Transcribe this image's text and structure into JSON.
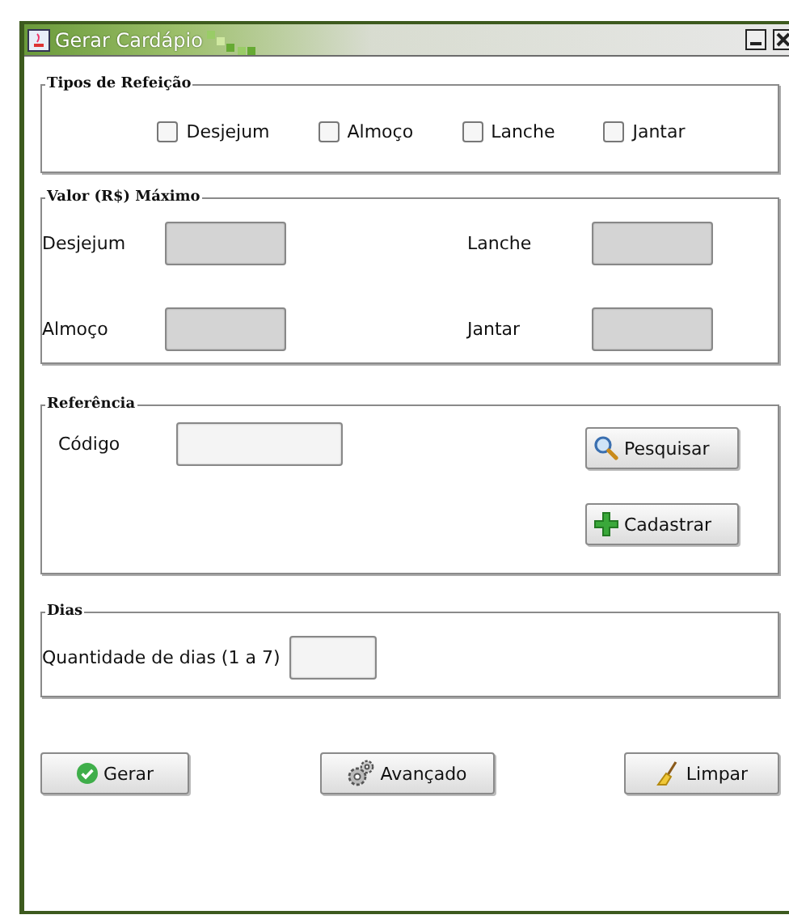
{
  "window": {
    "title": "Gerar Cardápio"
  },
  "groups": [
    {
      "kind": "checks",
      "title": "Tipos de Refeição",
      "items": [
        {
          "label": "Desjejum",
          "checked": false
        },
        {
          "label": "Almoço",
          "checked": false
        },
        {
          "label": "Lanche",
          "checked": false
        },
        {
          "label": "Jantar",
          "checked": false
        }
      ]
    },
    {
      "kind": "prices",
      "title": "Valor (R$) Máximo",
      "fields": [
        {
          "label": "Desjejum",
          "disabled": true
        },
        {
          "label": "Lanche",
          "disabled": true
        },
        {
          "label": "Almoço",
          "disabled": true
        },
        {
          "label": "Jantar",
          "disabled": true
        }
      ]
    },
    {
      "kind": "reference",
      "title": "Referência",
      "field": {
        "label": "Código",
        "disabled": false
      },
      "buttons": [
        {
          "label": "Pesquisar",
          "kind": "search"
        },
        {
          "label": "Cadastrar",
          "kind": "add"
        }
      ]
    },
    {
      "kind": "days",
      "title": "Dias",
      "field": {
        "label": "Quantidade de dias (1 a 7)",
        "disabled": false
      }
    }
  ],
  "buttons": [
    {
      "label": "Gerar",
      "kind": "generate"
    },
    {
      "label": "Avançado",
      "kind": "advanced"
    },
    {
      "label": "Limpar",
      "kind": "clear"
    }
  ]
}
